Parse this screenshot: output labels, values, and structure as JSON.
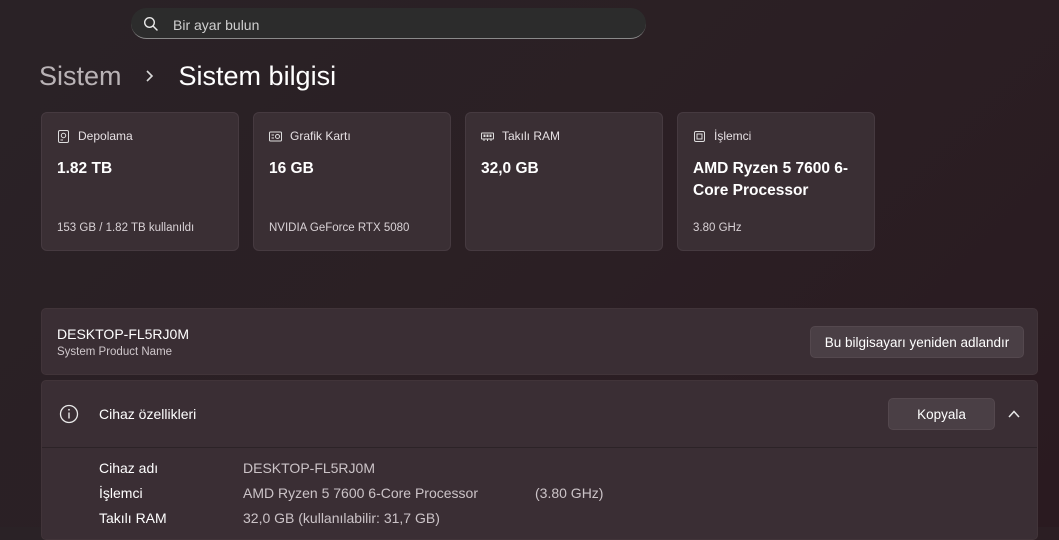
{
  "search": {
    "placeholder": "Bir ayar bulun",
    "icon": "search-icon"
  },
  "breadcrumb": {
    "parent": "Sistem",
    "current": "Sistem bilgisi"
  },
  "cards": [
    {
      "label": "Depolama",
      "value": "1.82 TB",
      "sub": "153 GB / 1.82 TB kullanıldı",
      "icon": "storage-icon"
    },
    {
      "label": "Grafik Kartı",
      "value": "16 GB",
      "sub": "NVIDIA GeForce RTX 5080",
      "icon": "gpu-icon"
    },
    {
      "label": "Takılı RAM",
      "value": "32,0 GB",
      "sub": "",
      "icon": "ram-icon"
    },
    {
      "label": "İşlemci",
      "value": "AMD Ryzen 5 7600 6-Core Processor",
      "sub": "3.80 GHz",
      "icon": "processor-icon"
    }
  ],
  "device": {
    "name": "DESKTOP-FL5RJ0M",
    "product": "System Product Name",
    "rename_label": "Bu bilgisayarı yeniden adlandır"
  },
  "specs": {
    "title": "Cihaz özellikleri",
    "copy_label": "Kopyala",
    "rows": [
      {
        "key": "Cihaz adı",
        "value": "DESKTOP-FL5RJ0M",
        "extra": ""
      },
      {
        "key": "İşlemci",
        "value": "AMD Ryzen 5 7600 6-Core Processor",
        "extra": "(3.80 GHz)"
      },
      {
        "key": "Takılı RAM",
        "value": "32,0 GB (kullanılabilir: 31,7 GB)",
        "extra": ""
      }
    ]
  }
}
